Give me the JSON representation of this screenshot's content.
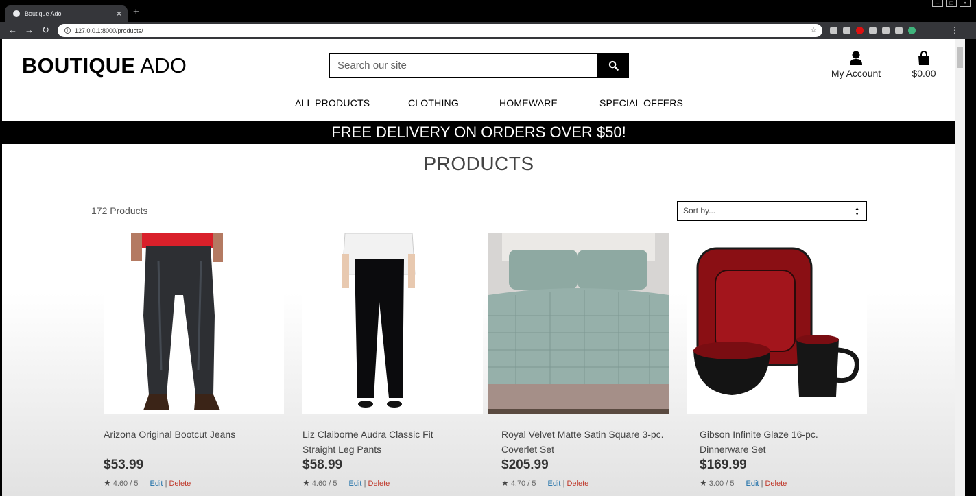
{
  "browser": {
    "tab_title": "Boutique Ado",
    "url": "127.0.0.1:8000/products/"
  },
  "header": {
    "logo_bold": "BOUTIQUE",
    "logo_light": "ADO",
    "search_placeholder": "Search our site",
    "account_label": "My Account",
    "bag_total": "$0.00"
  },
  "nav": {
    "items": [
      {
        "label": "ALL PRODUCTS"
      },
      {
        "label": "CLOTHING"
      },
      {
        "label": "HOMEWARE"
      },
      {
        "label": "SPECIAL OFFERS"
      }
    ]
  },
  "banner": {
    "text": "FREE DELIVERY ON ORDERS OVER $50!"
  },
  "page": {
    "title": "PRODUCTS",
    "count": "172 Products",
    "sort_label": "Sort by..."
  },
  "products": [
    {
      "name": "Arizona Original Bootcut Jeans",
      "price": "$53.99",
      "rating": "4.60 / 5",
      "edit": "Edit",
      "delete": "Delete"
    },
    {
      "name": "Liz Claiborne Audra Classic Fit Straight Leg Pants",
      "price": "$58.99",
      "rating": "4.60 / 5",
      "edit": "Edit",
      "delete": "Delete"
    },
    {
      "name": "Royal Velvet Matte Satin Square 3-pc. Coverlet Set",
      "price": "$205.99",
      "rating": "4.70 / 5",
      "edit": "Edit",
      "delete": "Delete"
    },
    {
      "name": "Gibson Infinite Glaze 16-pc. Dinnerware Set",
      "price": "$169.99",
      "rating": "3.00 / 5",
      "edit": "Edit",
      "delete": "Delete"
    }
  ]
}
